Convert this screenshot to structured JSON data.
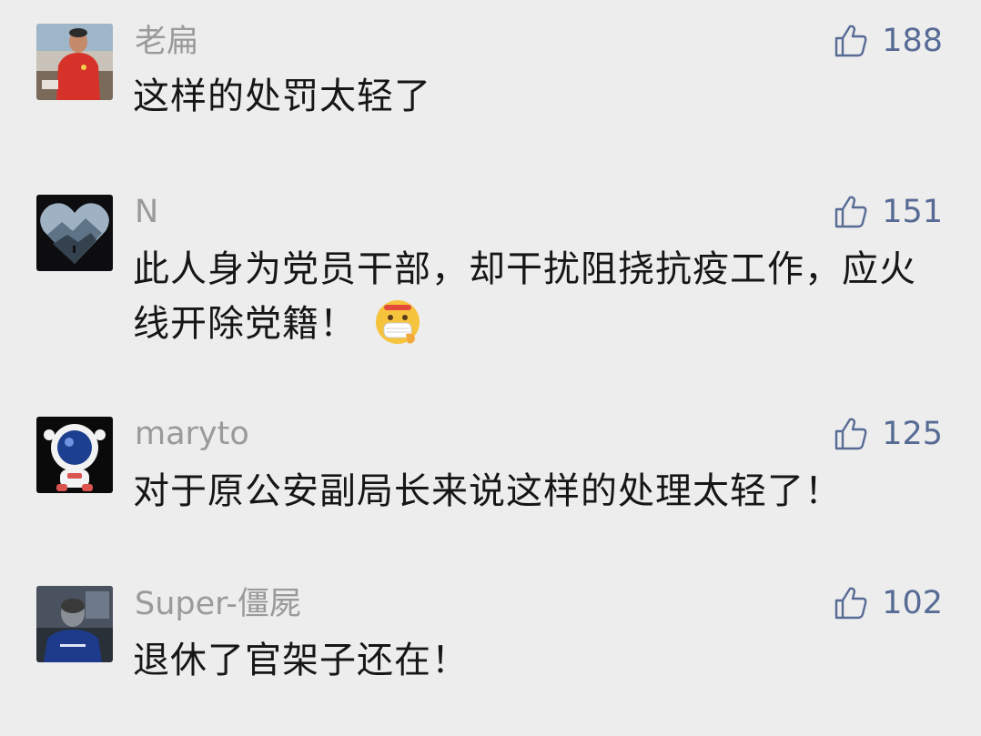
{
  "comments": [
    {
      "username": "老扁",
      "text": "这样的处罚太轻了",
      "likes": "188",
      "avatar_icon": "man-red-shirt-avatar"
    },
    {
      "username": "N",
      "text": "此人身为党员干部，却干扰阻挠抗疫工作，应火线开除党籍！",
      "likes": "151",
      "avatar_icon": "heart-mountain-avatar",
      "emoji_icon": "mask-face-emoji"
    },
    {
      "username": "maryto",
      "text": "对于原公安副局长来说这样的处理太轻了！",
      "likes": "125",
      "avatar_icon": "astronaut-avatar"
    },
    {
      "username": "Super-僵屍",
      "text": "退休了官架子还在！",
      "likes": "102",
      "avatar_icon": "man-back-avatar"
    }
  ],
  "colors": {
    "background": "#ededed",
    "username": "#9a9a9a",
    "text": "#161616",
    "like": "#576b95"
  }
}
